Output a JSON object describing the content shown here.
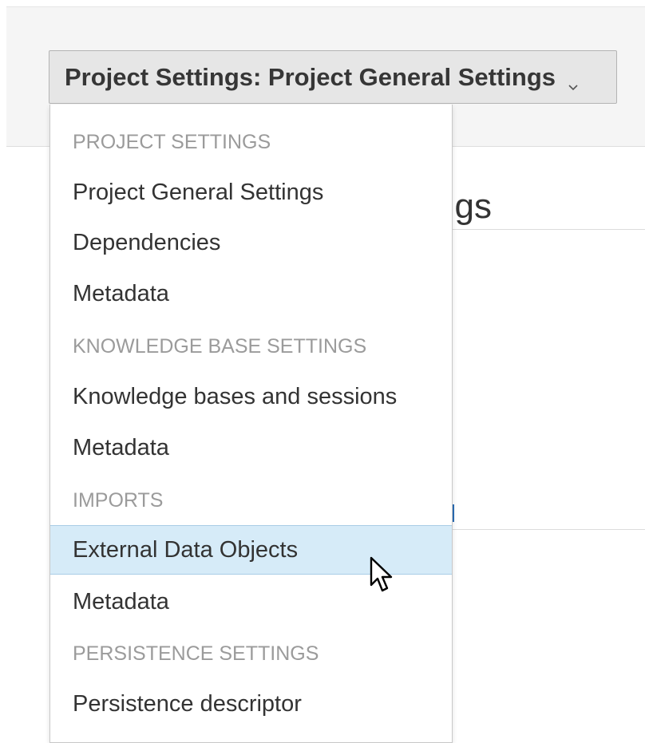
{
  "selector": {
    "label": "Project Settings: Project General Settings"
  },
  "background": {
    "heading_fragment": "ngs"
  },
  "menu": {
    "groups": [
      {
        "header": "PROJECT SETTINGS",
        "items": [
          "Project General Settings",
          "Dependencies",
          "Metadata"
        ]
      },
      {
        "header": "KNOWLEDGE BASE SETTINGS",
        "items": [
          "Knowledge bases and sessions",
          "Metadata"
        ]
      },
      {
        "header": "IMPORTS",
        "items": [
          "External Data Objects",
          "Metadata"
        ]
      },
      {
        "header": "PERSISTENCE SETTINGS",
        "items": [
          "Persistence descriptor"
        ]
      }
    ],
    "active_item": "External Data Objects"
  },
  "colors": {
    "active_item_background": "#d6ebf8",
    "header_text": "#9b9b9b",
    "item_text": "#333333"
  },
  "icons": {
    "selector_chevron": "chevron-down-icon",
    "pointer": "mouse-cursor-icon"
  }
}
